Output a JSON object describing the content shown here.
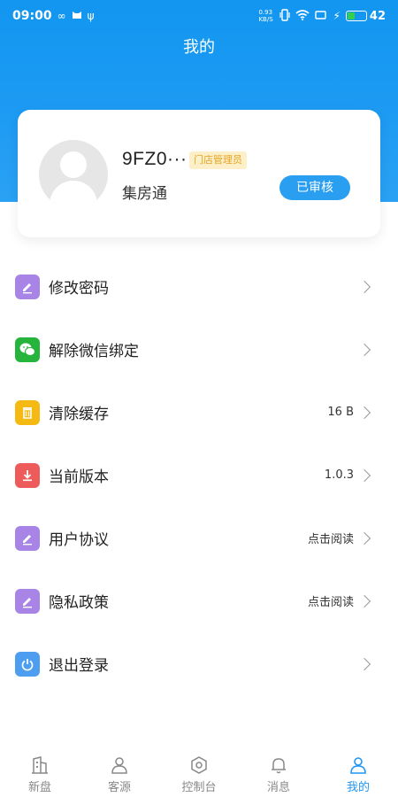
{
  "status_bar": {
    "time": "09:00",
    "battery": "42",
    "net_speed": "0.93 KB/S"
  },
  "header": {
    "title": "我的"
  },
  "profile": {
    "name": "9FZ0···",
    "role": "门店管理员",
    "company": "集房通",
    "status": "已审核"
  },
  "menu": [
    {
      "label": "修改密码",
      "value": "",
      "icon": "edit-icon",
      "color": "#a784e6"
    },
    {
      "label": "解除微信绑定",
      "value": "",
      "icon": "wechat-icon",
      "color": "#26b43c"
    },
    {
      "label": "清除缓存",
      "value": "16 B",
      "icon": "trash-icon",
      "color": "#f5b913"
    },
    {
      "label": "当前版本",
      "value": "1.0.3",
      "icon": "download-icon",
      "color": "#ee5b5b"
    },
    {
      "label": "用户协议",
      "value": "点击阅读",
      "icon": "edit-icon",
      "color": "#a784e6"
    },
    {
      "label": "隐私政策",
      "value": "点击阅读",
      "icon": "edit-icon",
      "color": "#a784e6"
    },
    {
      "label": "退出登录",
      "value": "",
      "icon": "power-icon",
      "color": "#4d9ef0"
    }
  ],
  "bottom_nav": [
    {
      "label": "新盘",
      "icon": "building-icon",
      "active": false
    },
    {
      "label": "客源",
      "icon": "customer-icon",
      "active": false
    },
    {
      "label": "控制台",
      "icon": "console-icon",
      "active": false
    },
    {
      "label": "消息",
      "icon": "bell-icon",
      "active": false
    },
    {
      "label": "我的",
      "icon": "user-icon",
      "active": true
    }
  ],
  "colors": {
    "primary": "#2196f3",
    "header_bg": "#1e9bf3",
    "badge_bg": "#fdf0c9",
    "badge_text": "#e3a423"
  }
}
